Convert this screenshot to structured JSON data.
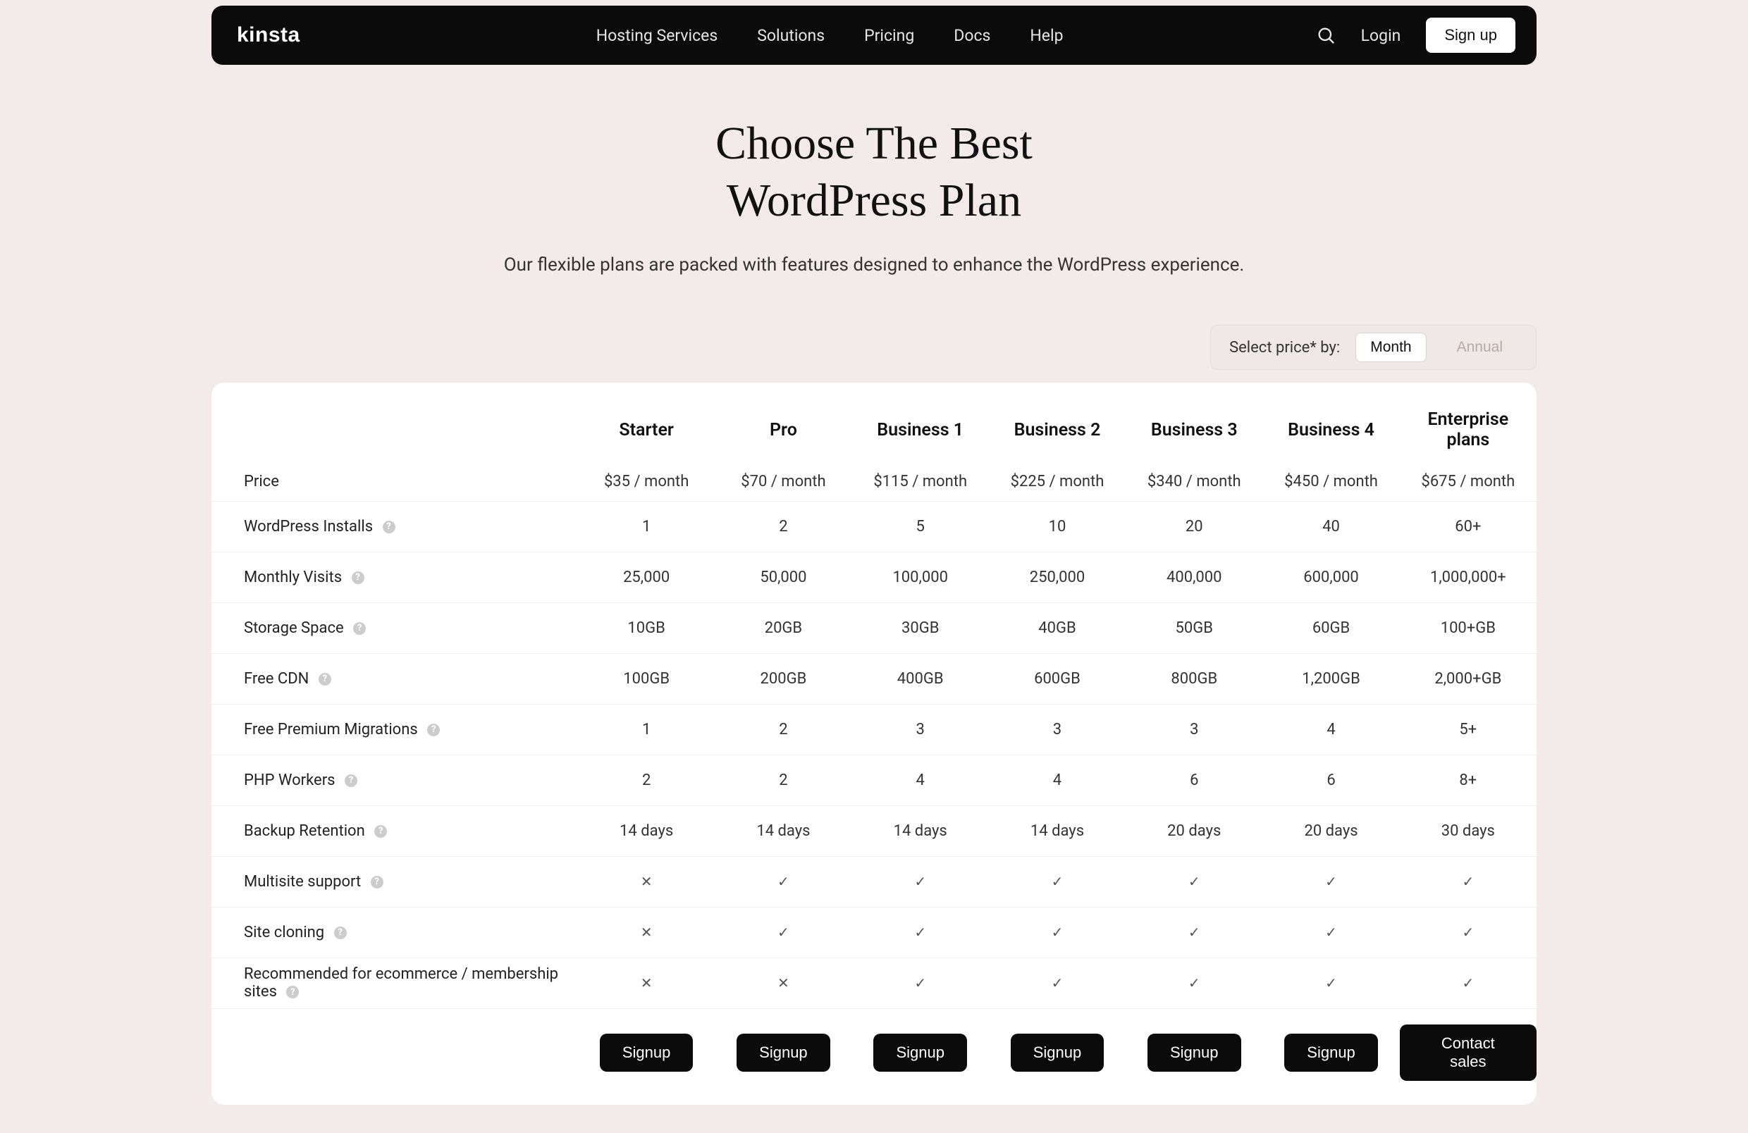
{
  "nav": {
    "logo": "kinsta",
    "links": [
      "Hosting Services",
      "Solutions",
      "Pricing",
      "Docs",
      "Help"
    ],
    "login": "Login",
    "signup": "Sign up"
  },
  "hero": {
    "title": "Choose The Best\nWordPress Plan",
    "subtitle": "Our flexible plans are packed with features designed to enhance the WordPress experience."
  },
  "toggle": {
    "label": "Select price* by:",
    "month": "Month",
    "annual": "Annual",
    "active": "month"
  },
  "plans": [
    "Starter",
    "Pro",
    "Business 1",
    "Business 2",
    "Business 3",
    "Business 4",
    "Enterprise plans"
  ],
  "rows": [
    {
      "label": "Price",
      "help": false,
      "values": [
        "$35 / month",
        "$70 / month",
        "$115 / month",
        "$225 / month",
        "$340 / month",
        "$450 / month",
        "$675 / month"
      ]
    },
    {
      "label": "WordPress Installs",
      "help": true,
      "values": [
        "1",
        "2",
        "5",
        "10",
        "20",
        "40",
        "60+"
      ]
    },
    {
      "label": "Monthly Visits",
      "help": true,
      "values": [
        "25,000",
        "50,000",
        "100,000",
        "250,000",
        "400,000",
        "600,000",
        "1,000,000+"
      ]
    },
    {
      "label": "Storage Space",
      "help": true,
      "values": [
        "10GB",
        "20GB",
        "30GB",
        "40GB",
        "50GB",
        "60GB",
        "100+GB"
      ]
    },
    {
      "label": "Free CDN",
      "help": true,
      "values": [
        "100GB",
        "200GB",
        "400GB",
        "600GB",
        "800GB",
        "1,200GB",
        "2,000+GB"
      ]
    },
    {
      "label": "Free Premium Migrations",
      "help": true,
      "values": [
        "1",
        "2",
        "3",
        "3",
        "3",
        "4",
        "5+"
      ]
    },
    {
      "label": "PHP Workers",
      "help": true,
      "values": [
        "2",
        "2",
        "4",
        "4",
        "6",
        "6",
        "8+"
      ]
    },
    {
      "label": "Backup Retention",
      "help": true,
      "values": [
        "14 days",
        "14 days",
        "14 days",
        "14 days",
        "20 days",
        "20 days",
        "30 days"
      ]
    },
    {
      "label": "Multisite support",
      "help": true,
      "values": [
        "x",
        "check",
        "check",
        "check",
        "check",
        "check",
        "check"
      ]
    },
    {
      "label": "Site cloning",
      "help": true,
      "values": [
        "x",
        "check",
        "check",
        "check",
        "check",
        "check",
        "check"
      ]
    },
    {
      "label": "Recommended for ecommerce / membership sites",
      "help": true,
      "values": [
        "x",
        "x",
        "check",
        "check",
        "check",
        "check",
        "check"
      ]
    }
  ],
  "cta": [
    "Signup",
    "Signup",
    "Signup",
    "Signup",
    "Signup",
    "Signup",
    "Contact sales"
  ]
}
